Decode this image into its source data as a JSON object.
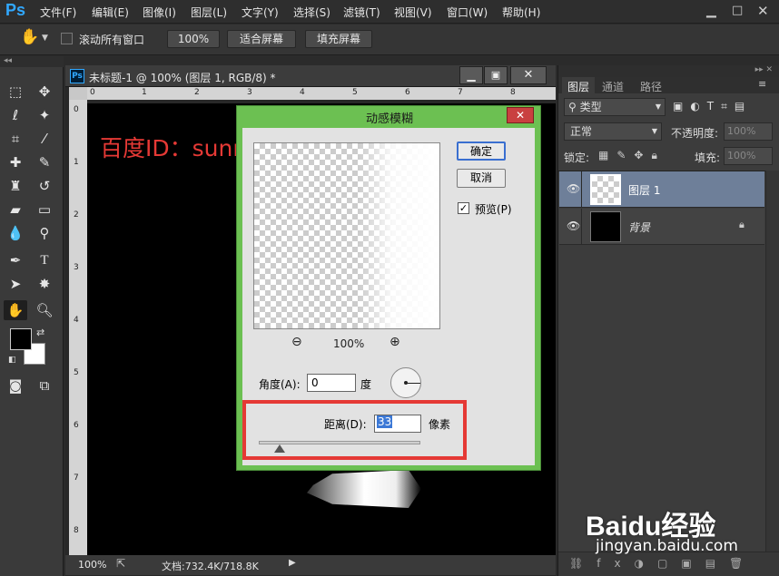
{
  "app": {
    "logo": "Ps"
  },
  "menus": [
    "文件(F)",
    "编辑(E)",
    "图像(I)",
    "图层(L)",
    "文字(Y)",
    "选择(S)",
    "滤镜(T)",
    "视图(V)",
    "窗口(W)",
    "帮助(H)"
  ],
  "options": {
    "scroll_all_label": "滚动所有窗口",
    "zoom_btn": "100%",
    "fit_btn": "适合屏幕",
    "fill_btn": "填充屏幕"
  },
  "document": {
    "tab_title": "未标题-1 @ 100% (图层 1, RGB/8) *",
    "h_ruler_labels": [
      "0",
      "1",
      "2",
      "3",
      "4",
      "5",
      "6",
      "7",
      "8"
    ],
    "v_ruler_labels": [
      "0",
      "1",
      "2",
      "3",
      "4",
      "5",
      "6",
      "7",
      "8"
    ],
    "watermark_text": "百度ID：sunnyMelody夏",
    "status_zoom": "100%",
    "status_doc": "文档:732.4K/718.8K"
  },
  "dialog": {
    "title": "动感模糊",
    "ok_label": "确定",
    "cancel_label": "取消",
    "preview_label": "预览(P)",
    "preview_checked": true,
    "zoom_level": "100%",
    "angle_label": "角度(A):",
    "angle_value": "0",
    "angle_unit": "度",
    "distance_label": "距离(D):",
    "distance_value": "33",
    "distance_unit": "像素",
    "distance_slider_position": 0.13
  },
  "layers_panel": {
    "tabs": [
      "图层",
      "通道",
      "路径"
    ],
    "filter_label": "类型",
    "blend_mode": "正常",
    "opacity_label": "不透明度:",
    "opacity_value": "100%",
    "lock_label": "锁定:",
    "fill_label": "填充:",
    "fill_value": "100%",
    "layers": [
      {
        "name": "图层 1",
        "selected": true,
        "thumb": "transparent"
      },
      {
        "name": "背景",
        "selected": false,
        "thumb": "black",
        "locked": true
      }
    ]
  },
  "watermark": {
    "brand": "Baidu经验",
    "url": "jingyan.baidu.com"
  },
  "colors": {
    "accent_red": "#e53935",
    "dialog_green": "#6cc052",
    "selected_layer": "#6e7f99",
    "ps_blue": "#31a8ff"
  }
}
